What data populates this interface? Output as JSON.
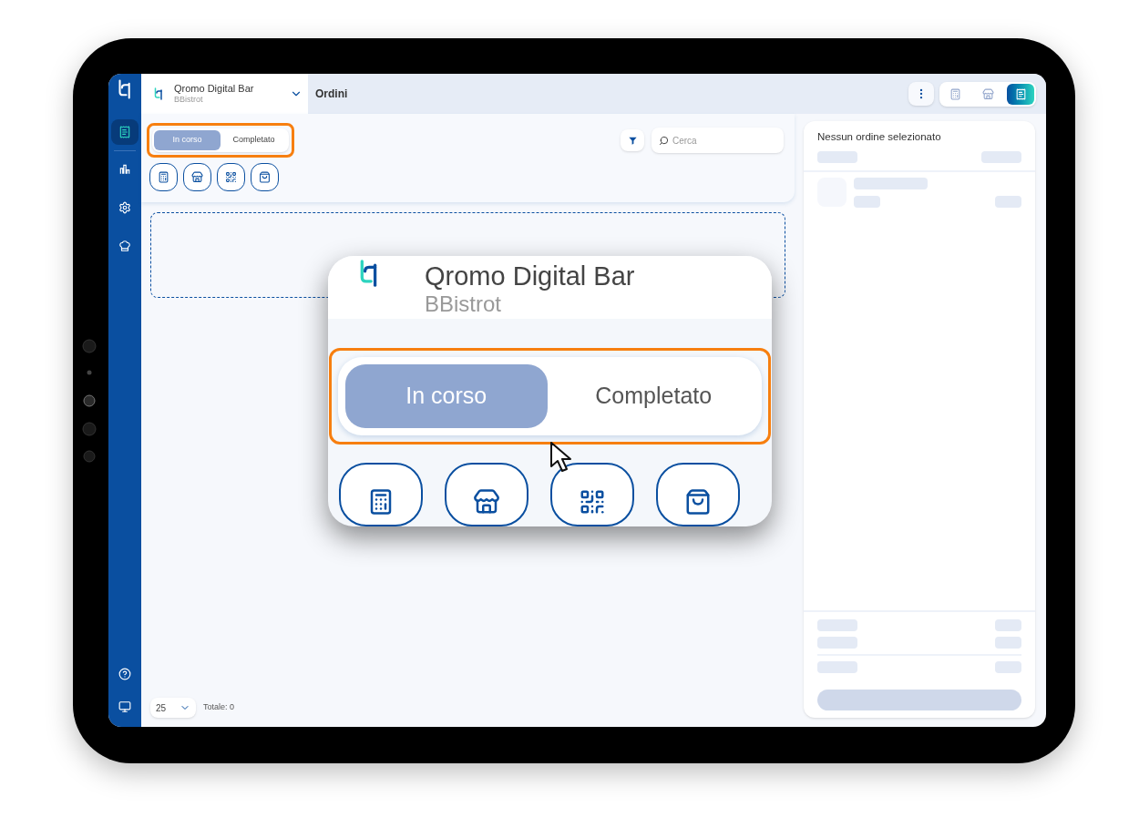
{
  "sidebar": {
    "items": [
      {
        "kind": "orders",
        "selected": true
      },
      {
        "kind": "stats",
        "selected": false
      },
      {
        "kind": "settings",
        "selected": false
      },
      {
        "kind": "kitchen",
        "selected": false
      }
    ],
    "bottom_items": [
      {
        "kind": "help"
      },
      {
        "kind": "display"
      }
    ]
  },
  "header": {
    "venue": "Qromo Digital Bar",
    "branch": "BBistrot",
    "page_title": "Ordini"
  },
  "view_buttons": [
    {
      "kind": "pos",
      "selected": false
    },
    {
      "kind": "table",
      "selected": false
    },
    {
      "kind": "orders",
      "selected": true
    }
  ],
  "status_tabs": [
    {
      "label": "In corso",
      "selected": true
    },
    {
      "label": "Completato",
      "selected": false
    }
  ],
  "search": {
    "placeholder": "Cerca"
  },
  "channel_filters": [
    {
      "kind": "pos"
    },
    {
      "kind": "table"
    },
    {
      "kind": "qr"
    },
    {
      "kind": "takeaway"
    }
  ],
  "pagination": {
    "page_size": "25",
    "total": "Totale: 0"
  },
  "detail": {
    "title": "Nessun ordine selezionato"
  },
  "callout": {
    "venue": "Qromo Digital Bar",
    "branch": "BBistrot",
    "status_tabs": [
      {
        "label": "In corso",
        "selected": true
      },
      {
        "label": "Completato",
        "selected": false
      }
    ],
    "channel_filters": [
      {
        "kind": "pos"
      },
      {
        "kind": "table"
      },
      {
        "kind": "qr"
      },
      {
        "kind": "takeaway"
      }
    ]
  }
}
